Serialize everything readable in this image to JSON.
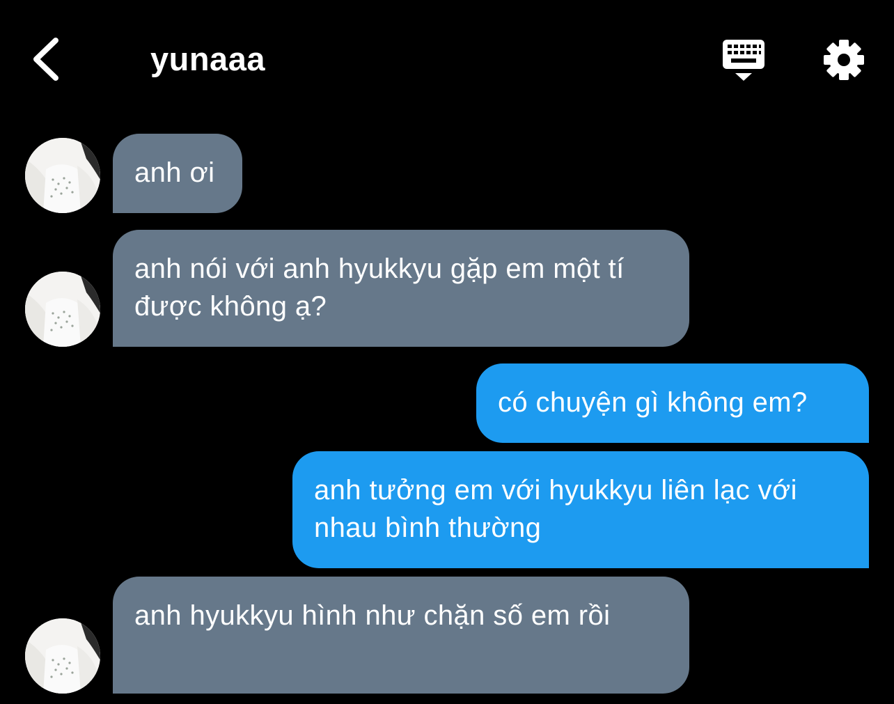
{
  "header": {
    "title": "yunaaa",
    "back_icon": "chevron-left-icon",
    "keyboard_icon": "keyboard-icon",
    "settings_icon": "gear-icon"
  },
  "colors": {
    "background": "#000000",
    "incoming_bubble": "#66788a",
    "outgoing_bubble": "#1d9bf0",
    "text": "#ffffff"
  },
  "messages": [
    {
      "from": "them",
      "text": "anh ơi"
    },
    {
      "from": "them",
      "text": "anh nói với anh hyukkyu gặp em một tí được không ạ?"
    },
    {
      "from": "me",
      "text": "có chuyện gì không em?"
    },
    {
      "from": "me",
      "text": "anh tưởng em với hyukkyu liên lạc với nhau bình thường"
    },
    {
      "from": "them",
      "text": "anh hyukkyu hình như chặn số em rồi"
    }
  ]
}
